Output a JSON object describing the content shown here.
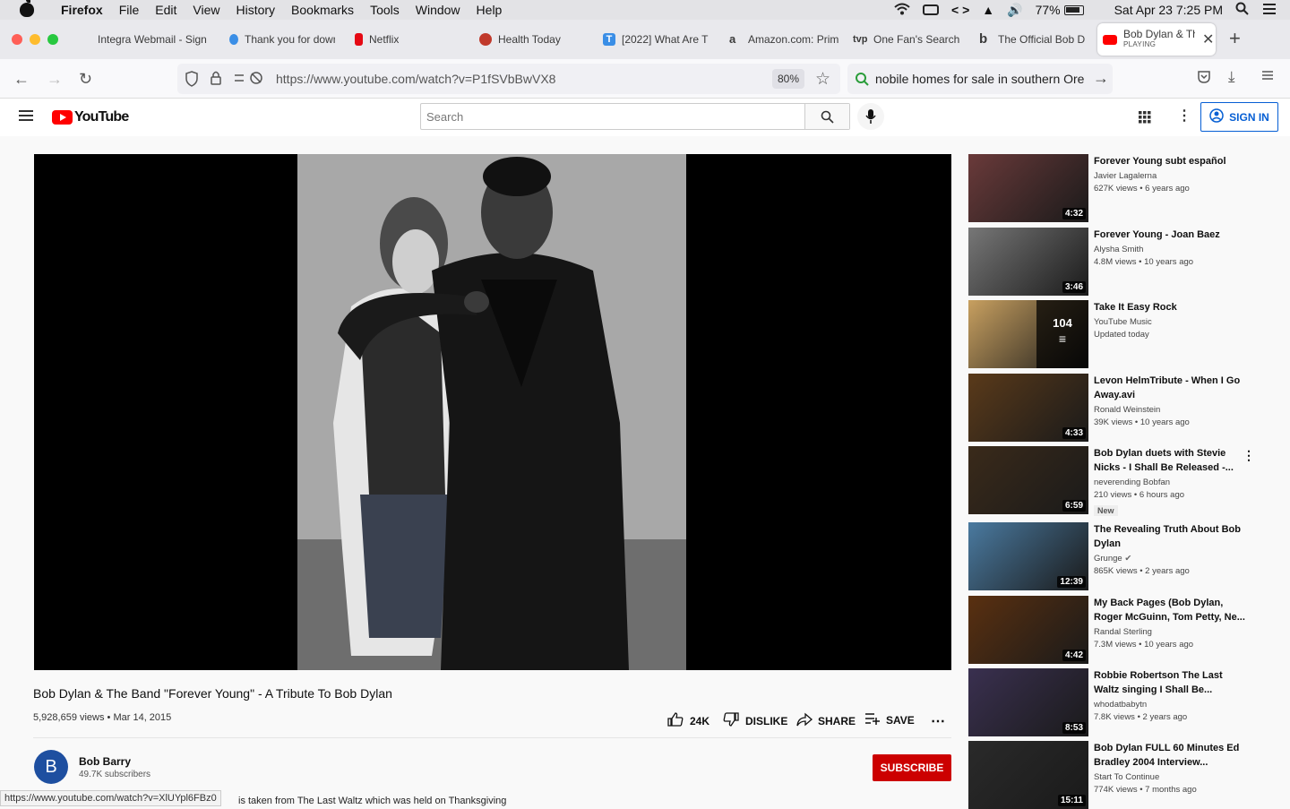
{
  "menubar": {
    "app": "Firefox",
    "items": [
      "File",
      "Edit",
      "View",
      "History",
      "Bookmarks",
      "Tools",
      "Window",
      "Help"
    ],
    "battery": "77%",
    "clock": "Sat Apr 23  7:25 PM"
  },
  "tabs": [
    {
      "label": "Integra Webmail - Sign",
      "color": "#8a8a8a"
    },
    {
      "label": "Thank you for down",
      "color": "#3a8ee6"
    },
    {
      "label": "Netflix",
      "color": "#e50914"
    },
    {
      "label": "Health Today",
      "color": "#c0392b"
    },
    {
      "label": "[2022] What Are T",
      "color": "#3a8ee6"
    },
    {
      "label": "Amazon.com: Prim",
      "color": "#222222"
    },
    {
      "label": "One Fan's Search f",
      "color": "#111111"
    },
    {
      "label": "The Official Bob D",
      "color": "#111111"
    }
  ],
  "active_tab": {
    "label": "Bob Dylan & Th",
    "sub": "PLAYING"
  },
  "nav": {
    "url": "https://www.youtube.com/watch?v=P1fSVbBwVX8",
    "zoom": "80%",
    "search_query": "nobile homes for sale in southern Ore"
  },
  "yt": {
    "logo": "YouTube",
    "search_placeholder": "Search",
    "signin": "SIGN IN"
  },
  "video": {
    "title": "Bob Dylan & The Band \"Forever Young\" - A Tribute To Bob Dylan",
    "meta": "5,928,659 views • Mar 14, 2015",
    "likes": "24K",
    "dislike": "DISLIKE",
    "share": "SHARE",
    "save": "SAVE",
    "channel": "Bob Barry",
    "avatar_letter": "B",
    "subscribers": "49.7K subscribers",
    "subscribe": "SUBSCRIBE",
    "description_fragment": "is taken from The Last Waltz which was held on Thanksgiving",
    "status_url": "https://www.youtube.com/watch?v=XlUYpl6FBz0"
  },
  "recommendations": [
    {
      "title": "Forever Young subt español",
      "channel": "Javier Lagalerna",
      "views": "627K views • 6 years ago",
      "duration": "4:32",
      "thumb": "#6a3a3a"
    },
    {
      "title": "Forever Young - Joan Baez",
      "channel": "Alysha Smith",
      "views": "4.8M views • 10 years ago",
      "duration": "3:46",
      "thumb": "#777777"
    },
    {
      "title": "Take It Easy Rock",
      "channel": "YouTube Music",
      "views": "Updated today",
      "duration": "",
      "playlist_count": "104",
      "thumb": "#c8a060"
    },
    {
      "title": "Levon HelmTribute - When I Go Away.avi",
      "channel": "Ronald Weinstein",
      "views": "39K views • 10 years ago",
      "duration": "4:33",
      "thumb": "#5a3a1a"
    },
    {
      "title": "Bob Dylan duets with Stevie Nicks - I Shall Be Released -...",
      "channel": "neverending Bobfan",
      "views": "210 views • 6 hours ago",
      "duration": "6:59",
      "badge": "New",
      "thumb": "#3a2a1a"
    },
    {
      "title": "The Revealing Truth About Bob Dylan",
      "channel": "Grunge",
      "views": "865K views • 2 years ago",
      "duration": "12:39",
      "thumb": "#4a7aa0"
    },
    {
      "title": "My Back Pages (Bob Dylan, Roger McGuinn, Tom Petty, Ne...",
      "channel": "Randal Sterling",
      "views": "7.3M views • 10 years ago",
      "duration": "4:42",
      "thumb": "#5a3010"
    },
    {
      "title": "Robbie Robertson The Last Waltz singing I Shall Be...",
      "channel": "whodatbabytn",
      "views": "7.8K views • 2 years ago",
      "duration": "8:53",
      "thumb": "#3a3050"
    },
    {
      "title": "Bob Dylan FULL 60 Minutes Ed Bradley 2004 Interview...",
      "channel": "Start To Continue",
      "views": "774K views • 7 months ago",
      "duration": "15:11",
      "thumb": "#2a2a2a"
    }
  ]
}
